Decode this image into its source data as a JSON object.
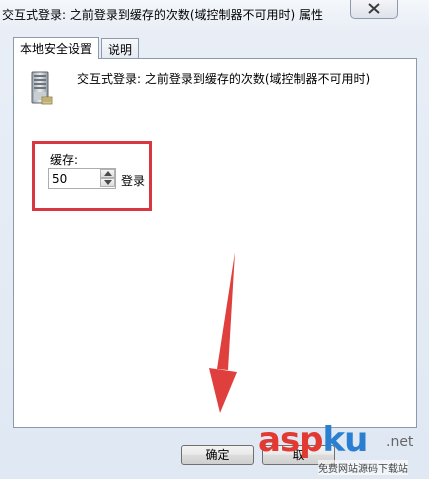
{
  "window": {
    "title": "交互式登录: 之前登录到缓存的次数(域控制器不可用时) 属性",
    "close_icon": "close-icon"
  },
  "tabs": [
    {
      "label": "本地安全设置",
      "active": true
    },
    {
      "label": "说明",
      "active": false
    }
  ],
  "policy": {
    "icon": "server-icon",
    "description": "交互式登录: 之前登录到缓存的次数(域控制器不可用时)"
  },
  "cache": {
    "label": "缓存:",
    "value": "50",
    "unit": "登录"
  },
  "buttons": {
    "ok": "确定",
    "cancel": "取"
  },
  "annotation": {
    "highlight_color": "#d8373f",
    "arrow_color": "#e0403d"
  },
  "watermark": {
    "brand_a": "asp",
    "brand_b": "ku",
    "tld": ".net",
    "tagline": "免费网站源码下载站"
  }
}
